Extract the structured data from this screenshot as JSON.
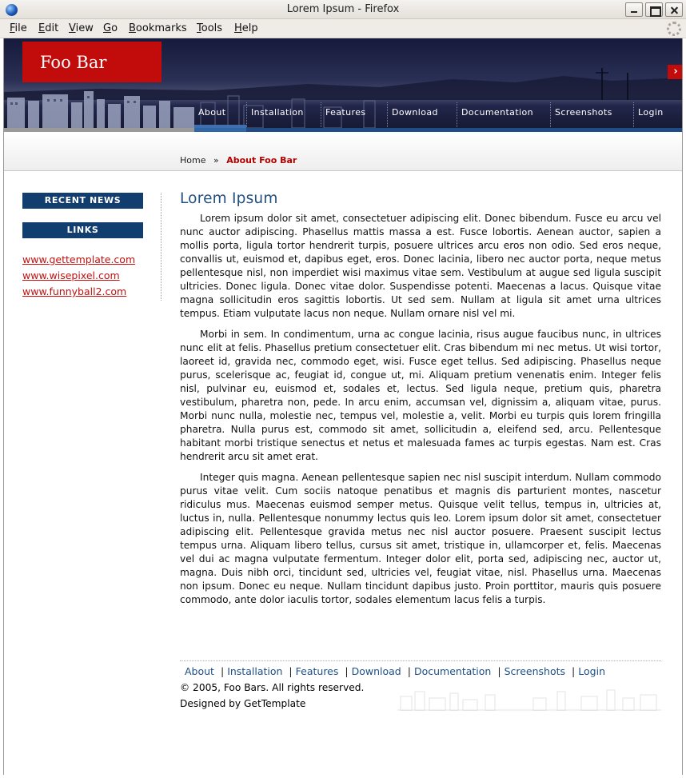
{
  "window": {
    "title": "Lorem Ipsum - Firefox"
  },
  "menubar": {
    "items": [
      "File",
      "Edit",
      "View",
      "Go",
      "Bookmarks",
      "Tools",
      "Help"
    ]
  },
  "site": {
    "logo": "Foo Bar",
    "nav": [
      "About",
      "Installation",
      "Features",
      "Download",
      "Documentation",
      "Screenshots",
      "Login"
    ],
    "active_nav": "About"
  },
  "breadcrumb": {
    "home": "Home",
    "separator": "»",
    "current": "About Foo Bar"
  },
  "sidebar": {
    "recent_news": "RECENT NEWS",
    "links_heading": "LINKS",
    "links": [
      "www.gettemplate.com",
      "www.wisepixel.com",
      "www.funnyball2.com"
    ]
  },
  "main": {
    "heading": "Lorem Ipsum",
    "paragraphs": [
      "Lorem ipsum dolor sit amet, consectetuer adipiscing elit. Donec bibendum. Fusce eu arcu vel nunc auctor adipiscing. Phasellus mattis massa a est. Fusce lobortis. Aenean auctor, sapien a mollis porta, ligula tortor hendrerit turpis, posuere ultrices arcu eros non odio. Sed eros neque, convallis ut, euismod et, dapibus eget, eros. Donec lacinia, libero nec auctor porta, neque metus pellentesque nisl, non imperdiet wisi maximus vitae sem. Vestibulum at augue sed ligula suscipit ultricies. Donec ligula. Donec vitae dolor. Suspendisse potenti. Maecenas a lacus. Quisque vitae magna sollicitudin eros sagittis lobortis. Ut sed sem. Nullam at ligula sit amet urna ultrices tempus. Etiam vulputate lacus non neque. Nullam ornare nisl vel mi.",
      "Morbi in sem. In condimentum, urna ac congue lacinia, risus augue faucibus nunc, in ultrices nunc elit at felis. Phasellus pretium consectetuer elit. Cras bibendum mi nec metus. Ut wisi tortor, laoreet id, gravida nec, commodo eget, wisi. Fusce eget tellus. Sed adipiscing. Phasellus neque purus, scelerisque ac, feugiat id, congue ut, mi. Aliquam pretium venenatis enim. Integer felis nisl, pulvinar eu, euismod et, sodales et, lectus. Sed ligula neque, pretium quis, pharetra vestibulum, pharetra non, pede. In arcu enim, accumsan vel, dignissim a, aliquam vitae, purus. Morbi nunc nulla, molestie nec, tempus vel, molestie a, velit. Morbi eu turpis quis lorem fringilla pharetra. Nulla purus est, commodo sit amet, sollicitudin a, eleifend sed, arcu. Pellentesque habitant morbi tristique senectus et netus et malesuada fames ac turpis egestas. Nam est. Cras hendrerit arcu sit amet erat.",
      "Integer quis magna. Aenean pellentesque sapien nec nisl suscipit interdum. Nullam commodo purus vitae velit. Cum sociis natoque penatibus et magnis dis parturient montes, nascetur ridiculus mus. Maecenas euismod semper metus. Quisque velit tellus, tempus in, ultricies at, luctus in, nulla. Pellentesque nonummy lectus quis leo. Lorem ipsum dolor sit amet, consectetuer adipiscing elit. Pellentesque gravida metus nec nisl auctor posuere. Praesent suscipit lectus tempus urna. Aliquam libero tellus, cursus sit amet, tristique in, ullamcorper et, felis. Maecenas vel dui ac magna vulputate fermentum. Integer dolor elit, porta sed, adipiscing nec, auctor ut, magna. Duis nibh orci, tincidunt sed, ultricies vel, feugiat vitae, nisl. Phasellus urna. Maecenas non ipsum. Donec eu neque. Nullam tincidunt dapibus justo. Proin porttitor, mauris quis posuere commodo, ante dolor iaculis tortor, sodales elementum lacus felis a turpis."
    ]
  },
  "footer": {
    "links": [
      "About",
      "Installation",
      "Features",
      "Download",
      "Documentation",
      "Screenshots",
      "Login"
    ],
    "separator": "|",
    "copyright": "© 2005, Foo Bars. All rights reserved.",
    "designed_by": "Designed by GetTemplate"
  },
  "colors": {
    "logo_red": "#c20b0b",
    "nav_blue": "#123d6f",
    "heading_blue": "#22507f",
    "link_red": "#c01010"
  },
  "icons": [
    "firefox-icon",
    "minimize-icon",
    "maximize-icon",
    "close-icon",
    "throbber-icon",
    "right-arrow-icon"
  ]
}
